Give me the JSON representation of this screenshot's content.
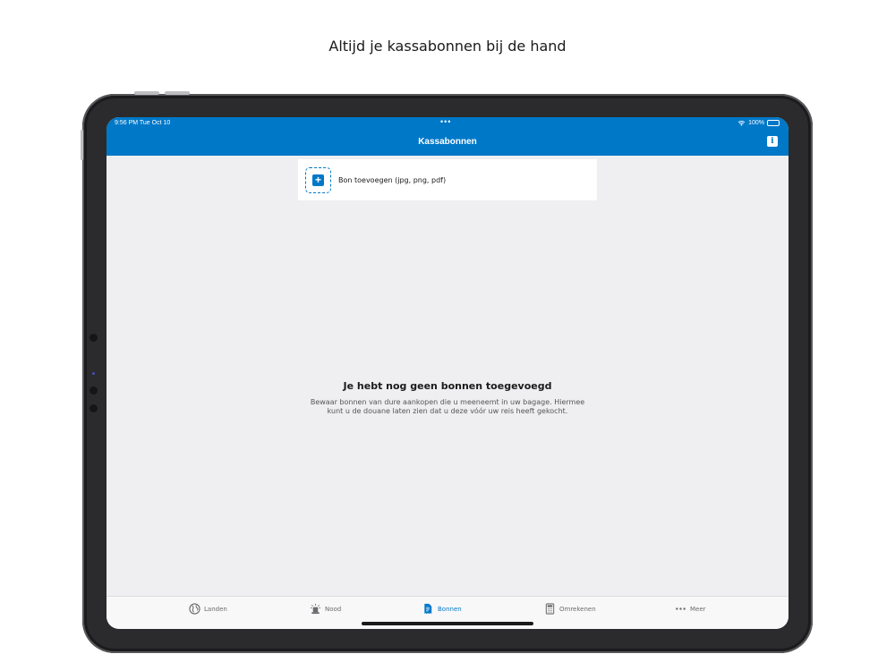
{
  "headline": "Altijd je kassabonnen bij de hand",
  "status": {
    "time": "9:56 PM  Tue Oct 10",
    "battery": "100%"
  },
  "nav": {
    "title": "Kassabonnen",
    "info_glyph": "i"
  },
  "add_receipt": {
    "label": "Bon toevoegen (jpg, png, pdf)",
    "icon": "plus-square-icon"
  },
  "empty_state": {
    "title": "Je hebt nog geen bonnen toegevoegd",
    "body": "Bewaar bonnen van dure aankopen die u meeneemt in uw bagage. Hiermee kunt u de douane laten zien dat u deze vóór uw reis heeft gekocht."
  },
  "tabs": [
    {
      "label": "Landen",
      "icon": "globe-icon",
      "active": false
    },
    {
      "label": "Nood",
      "icon": "siren-icon",
      "active": false
    },
    {
      "label": "Bonnen",
      "icon": "receipt-icon",
      "active": true
    },
    {
      "label": "Omrekenen",
      "icon": "calculator-icon",
      "active": false
    },
    {
      "label": "Meer",
      "icon": "more-dots-icon",
      "active": false
    }
  ],
  "colors": {
    "accent": "#0078c8",
    "background": "#efeff1",
    "tab_inactive": "#6b6b6f"
  }
}
